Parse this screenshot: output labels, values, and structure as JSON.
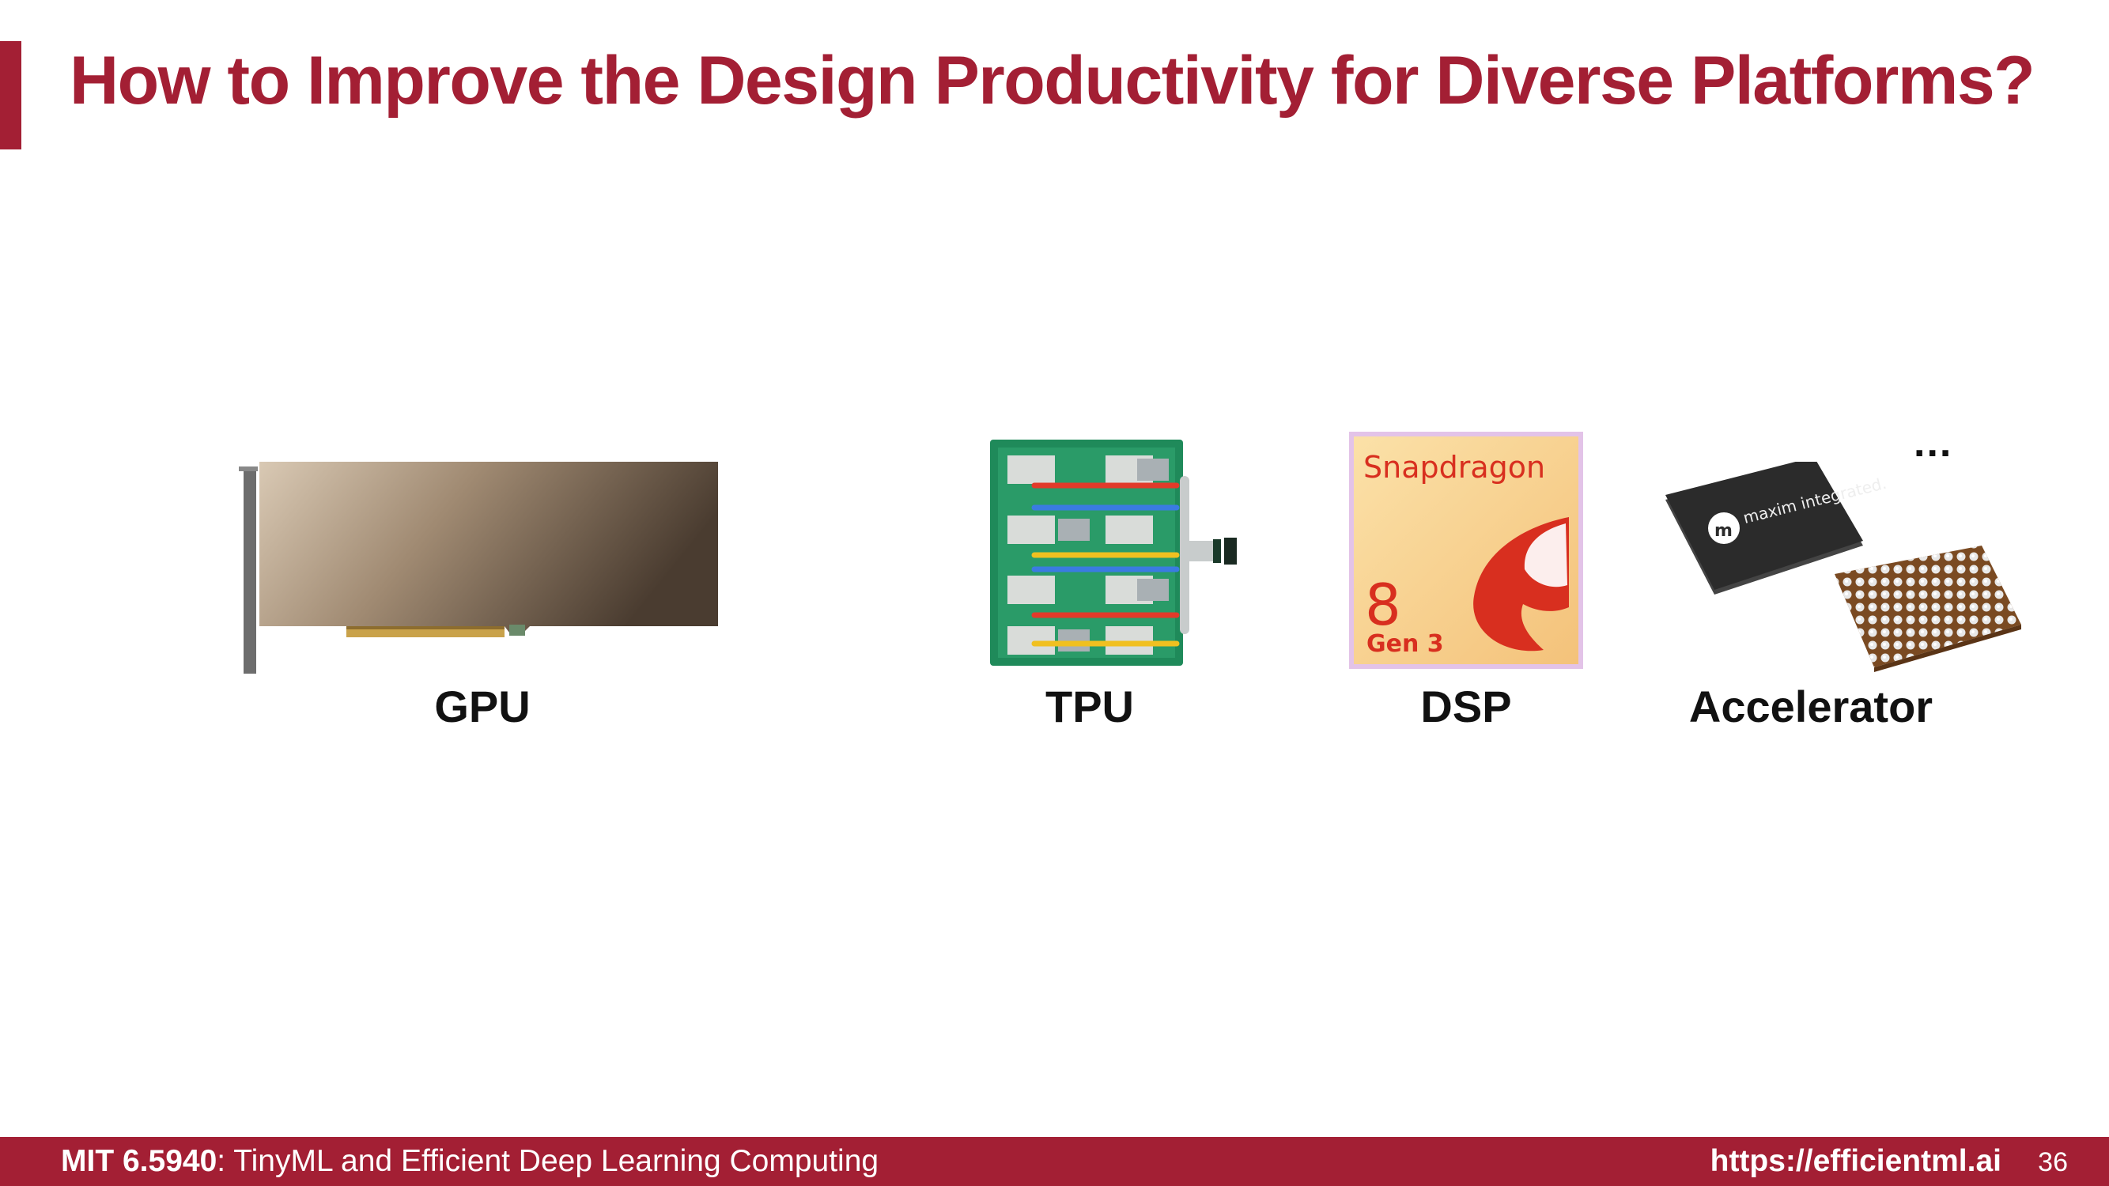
{
  "slide": {
    "title": "How to Improve the Design Productivity for Diverse Platforms?",
    "ellipsis": "...",
    "platforms": [
      {
        "label": "GPU",
        "icon": "gpu-card-image"
      },
      {
        "label": "TPU",
        "icon": "tpu-board-image"
      },
      {
        "label": "DSP",
        "icon": "snapdragon-chip-image",
        "logo_text": "Snapdragon",
        "logo_number": "8",
        "logo_gen": "Gen 3"
      },
      {
        "label": "Accelerator",
        "icon": "accelerator-chip-image",
        "logo_text": "maxim integrated."
      }
    ]
  },
  "footer": {
    "course_code": "MIT 6.5940",
    "course_name": ": TinyML and Efficient Deep Learning Computing",
    "url": "https://efficientml.ai",
    "page_number": "36"
  },
  "colors": {
    "accent": "#a31f34",
    "text": "#111111",
    "background": "#ffffff"
  }
}
